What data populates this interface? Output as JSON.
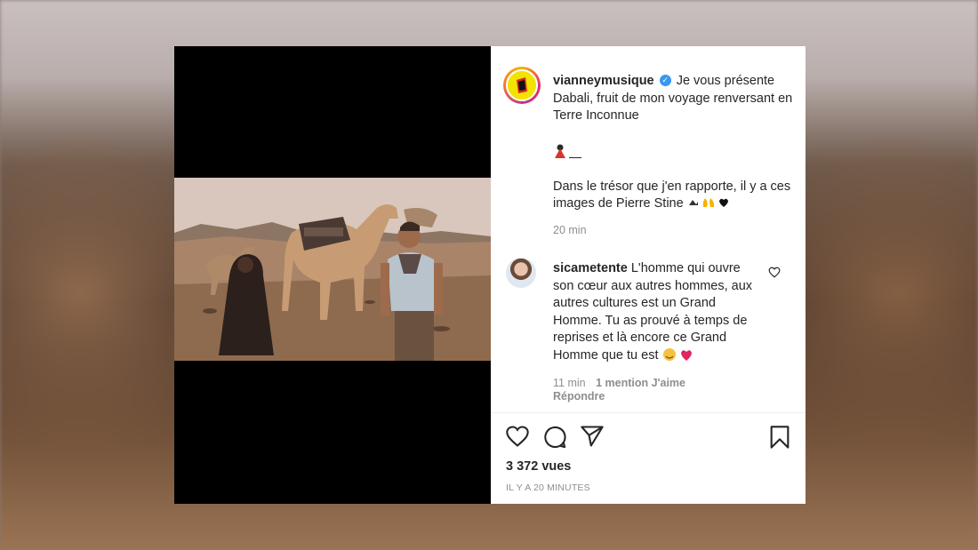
{
  "post": {
    "username": "vianneymusique",
    "caption_line1": "Je vous présente Dabali, fruit de mon voyage renversant en Terre Inconnue",
    "caption_line2": "Dans le trésor que j'en rapporte, il y a ces images de Pierre Stine",
    "time": "20 min"
  },
  "comment": {
    "username": "sicametente",
    "text": "L'homme qui ouvre son cœur aux autres hommes, aux autres cultures est un Grand Homme. Tu as prouvé à temps de reprises et là encore ce Grand Homme que tu est",
    "time": "11 min",
    "likes": "1 mention J'aime",
    "reply": "Répondre"
  },
  "footer": {
    "views": "3 372 vues",
    "ago": "IL Y A 20 MINUTES"
  },
  "icons": {
    "verified": "verified-badge-icon",
    "like": "heart-icon",
    "comment": "comment-bubble-icon",
    "share": "paper-plane-icon",
    "save": "bookmark-icon"
  },
  "colors": {
    "verified": "#3897f0",
    "text": "#262626",
    "muted": "#8e8e8e",
    "avatar_yellow": "#f2e300"
  }
}
